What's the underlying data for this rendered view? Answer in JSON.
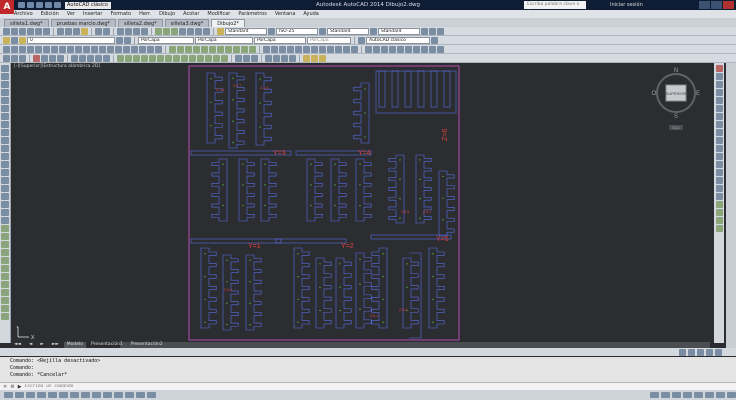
{
  "title_bar": {
    "app_title": "Autodesk AutoCAD 2014    Dibujo2.dwg",
    "workspace": "AutoCAD clásico",
    "search_placeholder": "Escriba palabra clave o frase",
    "sign_in": "Iniciar sesión"
  },
  "menu": [
    "Archivo",
    "Edición",
    "Ver",
    "Insertar",
    "Formato",
    "Herr.",
    "Dibujo",
    "Acotar",
    "Modificar",
    "Parámetros",
    "Ventana",
    "Ayuda"
  ],
  "file_tabs": [
    {
      "label": "silleta1.dwg*",
      "active": false
    },
    {
      "label": "pruebas marcio.dwg*",
      "active": false
    },
    {
      "label": "silleta2.dwg*",
      "active": false
    },
    {
      "label": "silleta3.dwg*",
      "active": false
    },
    {
      "label": "Dibujo2*",
      "active": true
    }
  ],
  "toolbar_row2": {
    "workspace": "AutoCAD clásico",
    "text_style": "Standard",
    "dim_style": "ISO-25",
    "table_style": "Standard",
    "mleader_style": "Standard"
  },
  "toolbar_row3": {
    "layer": "0",
    "color": "PorCapa",
    "linetype": "PorCapa",
    "lineweight": "PorCapa",
    "plotstyle": "PorCapa",
    "workspace": "AutoCAD clásico"
  },
  "viewport_label": "[-][Superior][Estructura alámbrica 2D]",
  "viewcube": {
    "n": "N",
    "s": "S",
    "e": "E",
    "w": "O",
    "face": "SUPERIOR",
    "wcs": "SCU"
  },
  "drawing": {
    "labels": [
      "Y=3",
      "Y=4",
      "Y=1",
      "Y=2",
      "Y=5",
      "Z=6"
    ],
    "small_labels": [
      "Z-1-9",
      "Z-1-7",
      "Z-1-5",
      "Z-5-5",
      "Z-5-7",
      "Z-5-1",
      "Z-3-1",
      "Z-3-3"
    ]
  },
  "layout_tabs": [
    {
      "label": "Modelo",
      "active": true
    },
    {
      "label": "Presentación1",
      "active": false
    },
    {
      "label": "Presentación2",
      "active": false
    }
  ],
  "command_history": [
    "Comando:  <Rejilla desactivado>",
    "Comando:",
    "Comando: *Cancelar*"
  ],
  "command_placeholder": "Escriba un comando"
}
